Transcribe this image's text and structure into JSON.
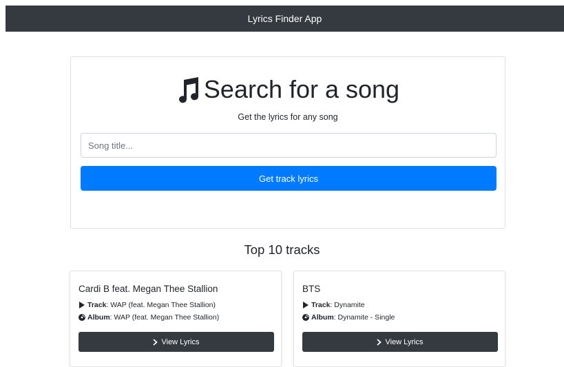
{
  "navbar": {
    "title": "Lyrics Finder App"
  },
  "search": {
    "icon": "music-note-icon",
    "heading": "Search for a song",
    "subtitle": "Get the lyrics for any song",
    "input_placeholder": "Song title...",
    "input_value": "",
    "button_label": "Get track lyrics"
  },
  "top_tracks": {
    "title": "Top 10 tracks",
    "cards": [
      {
        "artist": "Cardi B feat. Megan Thee Stallion",
        "track_label": "Track",
        "track_value": ": WAP (feat. Megan Thee Stallion)",
        "album_label": "Album",
        "album_value": ": WAP (feat. Megan Thee Stallion)",
        "button_label": "View Lyrics"
      },
      {
        "artist": "BTS",
        "track_label": "Track",
        "track_value": ": Dynamite",
        "album_label": "Album",
        "album_value": ": Dynamite - Single",
        "button_label": "View Lyrics"
      }
    ]
  },
  "colors": {
    "navbar": "#343a40",
    "primary": "#007bff",
    "dark_button": "#343a40"
  }
}
